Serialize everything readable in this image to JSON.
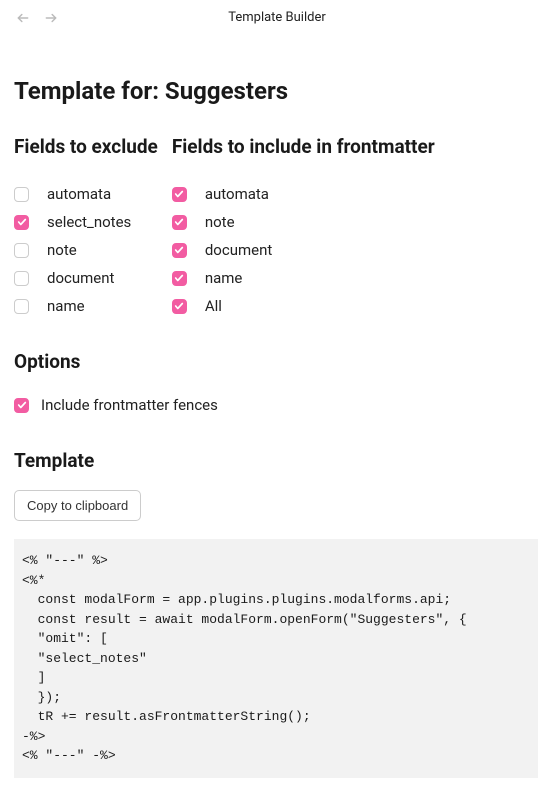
{
  "topbar": {
    "title": "Template Builder"
  },
  "page_title": "Template for: Suggesters",
  "exclude": {
    "heading": "Fields to exclude",
    "items": [
      {
        "label": "automata",
        "checked": false
      },
      {
        "label": "select_notes",
        "checked": true
      },
      {
        "label": "note",
        "checked": false
      },
      {
        "label": "document",
        "checked": false
      },
      {
        "label": "name",
        "checked": false
      }
    ]
  },
  "include": {
    "heading": "Fields to include in frontmatter",
    "items": [
      {
        "label": "automata",
        "checked": true
      },
      {
        "label": "note",
        "checked": true
      },
      {
        "label": "document",
        "checked": true
      },
      {
        "label": "name",
        "checked": true
      },
      {
        "label": "All",
        "checked": true
      }
    ]
  },
  "options": {
    "heading": "Options",
    "fences": {
      "label": "Include frontmatter fences",
      "checked": true
    }
  },
  "template": {
    "heading": "Template",
    "copy_label": "Copy to clipboard",
    "code": "<% \"---\" %>\n<%*\n  const modalForm = app.plugins.plugins.modalforms.api;\n  const result = await modalForm.openForm(\"Suggesters\", {\n  \"omit\": [\n  \"select_notes\"\n  ]\n  });\n  tR += result.asFrontmatterString();\n-%>\n<% \"---\" -%>"
  },
  "colors": {
    "accent": "#f25ca2"
  }
}
